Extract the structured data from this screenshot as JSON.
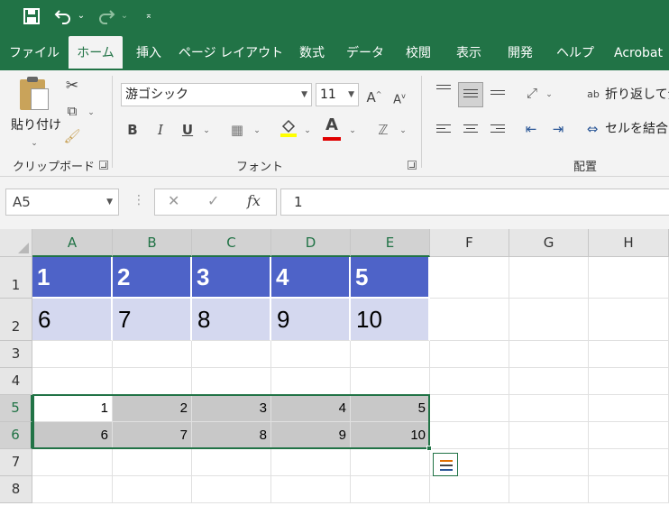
{
  "qat": {
    "save_icon": "save-icon",
    "undo_icon": "undo-icon",
    "redo_icon": "redo-icon",
    "customize_icon": "customize-qat-icon"
  },
  "tabs": [
    {
      "label": "ファイル",
      "active": false
    },
    {
      "label": "ホーム",
      "active": true
    },
    {
      "label": "挿入",
      "active": false
    },
    {
      "label": "ページ レイアウト",
      "active": false
    },
    {
      "label": "数式",
      "active": false
    },
    {
      "label": "データ",
      "active": false
    },
    {
      "label": "校閲",
      "active": false
    },
    {
      "label": "表示",
      "active": false
    },
    {
      "label": "開発",
      "active": false
    },
    {
      "label": "ヘルプ",
      "active": false
    },
    {
      "label": "Acrobat",
      "active": false
    }
  ],
  "ribbon": {
    "clipboard": {
      "paste_label": "貼り付け",
      "group_label": "クリップボード"
    },
    "font": {
      "font_name": "游ゴシック",
      "font_size": "11",
      "bold": "B",
      "italic": "I",
      "underline": "U",
      "font_color_letter": "A",
      "grow_letter": "A",
      "shrink_letter": "A",
      "group_label": "フォント",
      "fill_color": "#ffff00",
      "font_color": "#e00000"
    },
    "alignment": {
      "wrap_text": "折り返して全",
      "merge_center": "セルを結合し",
      "group_label": "配置"
    }
  },
  "formula_bar": {
    "name_box": "A5",
    "fx_label": "fx",
    "formula": "1"
  },
  "sheet": {
    "columns": [
      "A",
      "B",
      "C",
      "D",
      "E",
      "F",
      "G",
      "H"
    ],
    "selected_columns": [
      "A",
      "B",
      "C",
      "D",
      "E"
    ],
    "rows": [
      "1",
      "2",
      "3",
      "4",
      "5",
      "6",
      "7",
      "8"
    ],
    "selected_rows": [
      "5",
      "6"
    ],
    "row1": [
      "1",
      "2",
      "3",
      "4",
      "5"
    ],
    "row2": [
      "6",
      "7",
      "8",
      "9",
      "10"
    ],
    "row5": [
      "1",
      "2",
      "3",
      "4",
      "5"
    ],
    "row6": [
      "6",
      "7",
      "8",
      "9",
      "10"
    ],
    "header_fill": "#4e63c8",
    "band_fill": "#d4d8ef",
    "selection_fill": "#c8c8c8",
    "accent": "#217346"
  },
  "quick_analysis_icon": "quick-analysis-icon"
}
